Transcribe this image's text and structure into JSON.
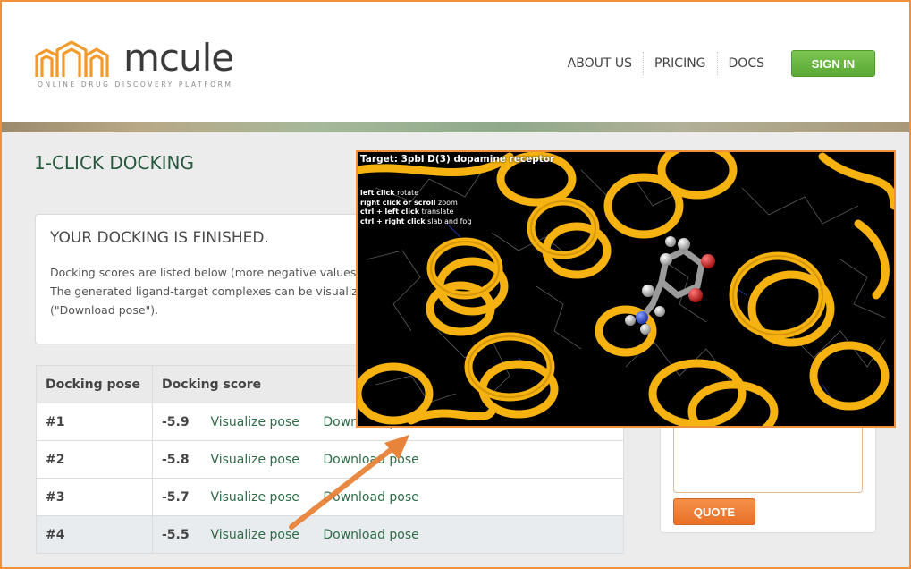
{
  "header": {
    "logo_text": "mcule",
    "logo_tagline": "ONLINE DRUG DISCOVERY PLATFORM",
    "nav": [
      "ABOUT US",
      "PRICING",
      "DOCS"
    ],
    "signin_label": "SIGN IN"
  },
  "page": {
    "title": "1-CLICK DOCKING"
  },
  "panel": {
    "heading": "YOUR DOCKING IS FINISHED.",
    "line1": "Docking scores are listed below (more negative values",
    "line2": "The generated ligand-target complexes can be visualiz",
    "line3": "(\"Download pose\")."
  },
  "table": {
    "headers": [
      "Docking pose",
      "Docking score"
    ],
    "rows": [
      {
        "pose": "#1",
        "score": "-5.9",
        "visualize": "Visualize pose",
        "download": "Download pose"
      },
      {
        "pose": "#2",
        "score": "-5.8",
        "visualize": "Visualize pose",
        "download": "Download pose"
      },
      {
        "pose": "#3",
        "score": "-5.7",
        "visualize": "Visualize pose",
        "download": "Download pose"
      },
      {
        "pose": "#4",
        "score": "-5.5",
        "visualize": "Visualize pose",
        "download": "Download pose"
      }
    ]
  },
  "quote": {
    "button_label": "QUOTE"
  },
  "viewer": {
    "target_label": "Target: 3pbl D(3) dopamine receptor",
    "help": [
      {
        "key": "left click",
        "action": "rotate"
      },
      {
        "key": "right click or scroll",
        "action": "zoom"
      },
      {
        "key": "ctrl + left click",
        "action": "translate"
      },
      {
        "key": "ctrl + right click",
        "action": "slab and fog"
      }
    ]
  },
  "colors": {
    "accent_orange": "#f0913a",
    "brand_green": "#5ba836",
    "title_green": "#26593d",
    "ribbon_yellow": "#f5b210"
  }
}
